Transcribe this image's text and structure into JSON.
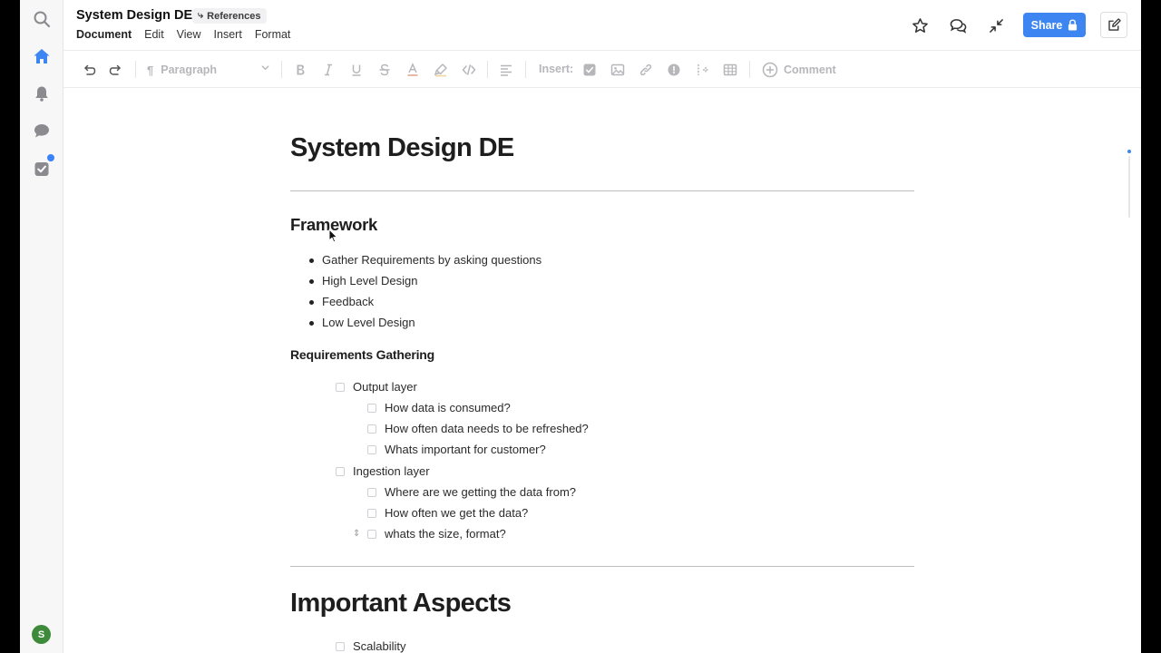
{
  "app": {
    "doc_title": "System Design DE",
    "references_chip": "References",
    "menu": [
      "Document",
      "Edit",
      "View",
      "Insert",
      "Format"
    ],
    "share_label": "Share",
    "avatar_initial": "S"
  },
  "toolbar": {
    "paragraph_label": "Paragraph",
    "insert_label": "Insert:",
    "comment_label": "Comment"
  },
  "document": {
    "title": "System Design DE",
    "framework_heading": "Framework",
    "framework_items": [
      "Gather Requirements by asking questions",
      "High Level Design",
      "Feedback",
      "Low Level Design"
    ],
    "requirements_heading": "Requirements Gathering",
    "output_layer": {
      "label": "Output layer",
      "items": [
        "How data is consumed?",
        "How often data needs to be refreshed?",
        "Whats important for customer?"
      ]
    },
    "ingestion_layer": {
      "label": "Ingestion layer",
      "items": [
        "Where are we getting the data from?",
        "How often we get the data?",
        "whats the size, format?"
      ]
    },
    "important_heading": "Important Aspects",
    "important_items": [
      "Scalability"
    ]
  },
  "icons": {
    "rail": [
      "search-icon",
      "home-icon",
      "bell-icon",
      "chat-icon",
      "tasks-icon"
    ],
    "header": [
      "star-icon",
      "comments-icon",
      "collapse-icon",
      "lock-icon",
      "edit-icon"
    ]
  },
  "colors": {
    "accent": "#3d86f2",
    "rail_icon": "#8a8a8f",
    "home_active": "#3d86f2",
    "avatar": "#3d8a3a"
  }
}
